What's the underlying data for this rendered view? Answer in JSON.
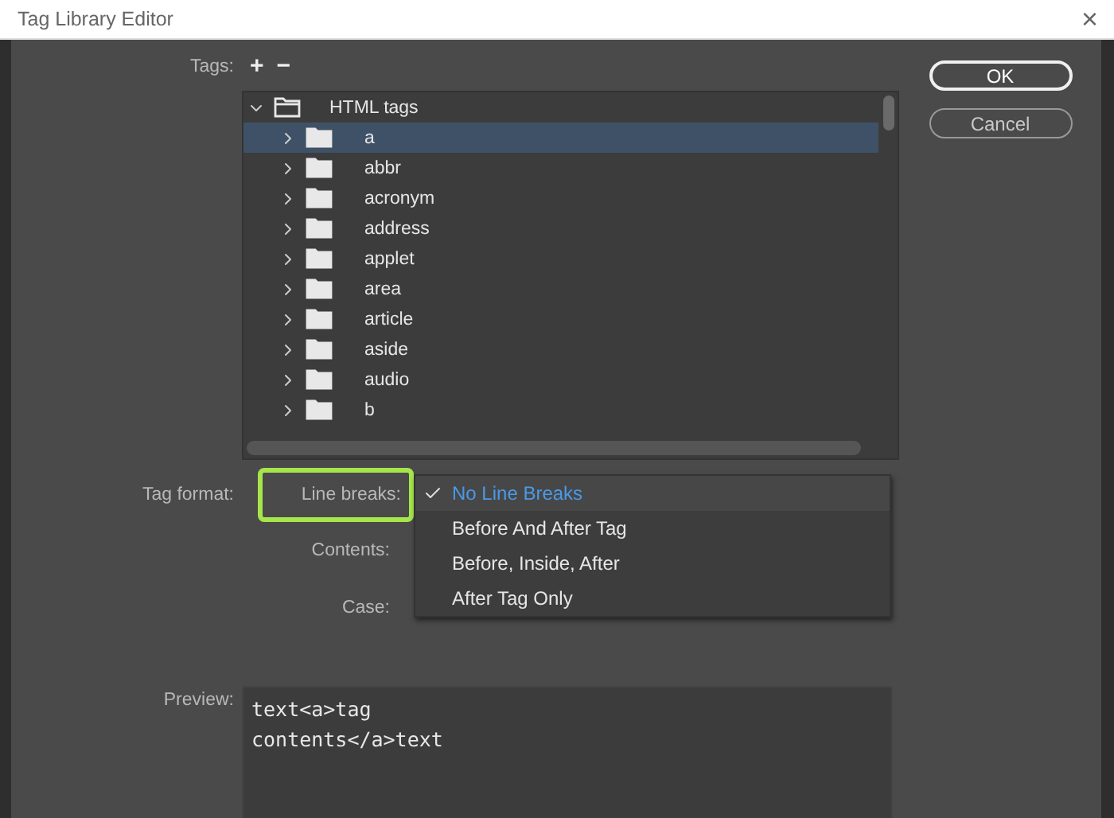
{
  "window": {
    "title": "Tag Library Editor",
    "close": "×"
  },
  "buttons": [
    {
      "label": "OK",
      "kind": "default"
    },
    {
      "label": "Cancel",
      "kind": "normal"
    }
  ],
  "tags": {
    "label": "Tags:",
    "add": "+",
    "remove": "−",
    "tree": [
      {
        "label": "HTML tags",
        "expanded": true,
        "selected": false,
        "children": [
          {
            "label": "a",
            "expanded": false,
            "selected": true
          },
          {
            "label": "abbr",
            "expanded": false,
            "selected": false
          },
          {
            "label": "acronym",
            "expanded": false,
            "selected": false
          },
          {
            "label": "address",
            "expanded": false,
            "selected": false
          },
          {
            "label": "applet",
            "expanded": false,
            "selected": false
          },
          {
            "label": "area",
            "expanded": false,
            "selected": false
          },
          {
            "label": "article",
            "expanded": false,
            "selected": false
          },
          {
            "label": "aside",
            "expanded": false,
            "selected": false
          },
          {
            "label": "audio",
            "expanded": false,
            "selected": false
          },
          {
            "label": "b",
            "expanded": false,
            "selected": false
          }
        ]
      }
    ]
  },
  "tag_format": {
    "label": "Tag format:",
    "fields": [
      {
        "label": "Line breaks:",
        "highlighted": true
      },
      {
        "label": "Contents:",
        "highlighted": false
      },
      {
        "label": "Case:",
        "highlighted": false
      }
    ],
    "dropdown": [
      {
        "label": "No Line Breaks",
        "selected": true
      },
      {
        "label": "Before And After Tag",
        "selected": false
      },
      {
        "label": "Before, Inside, After",
        "selected": false
      },
      {
        "label": "After Tag Only",
        "selected": false
      }
    ]
  },
  "preview": {
    "label": "Preview:",
    "lines": [
      "text<a>tag",
      "contents</a>text"
    ]
  }
}
